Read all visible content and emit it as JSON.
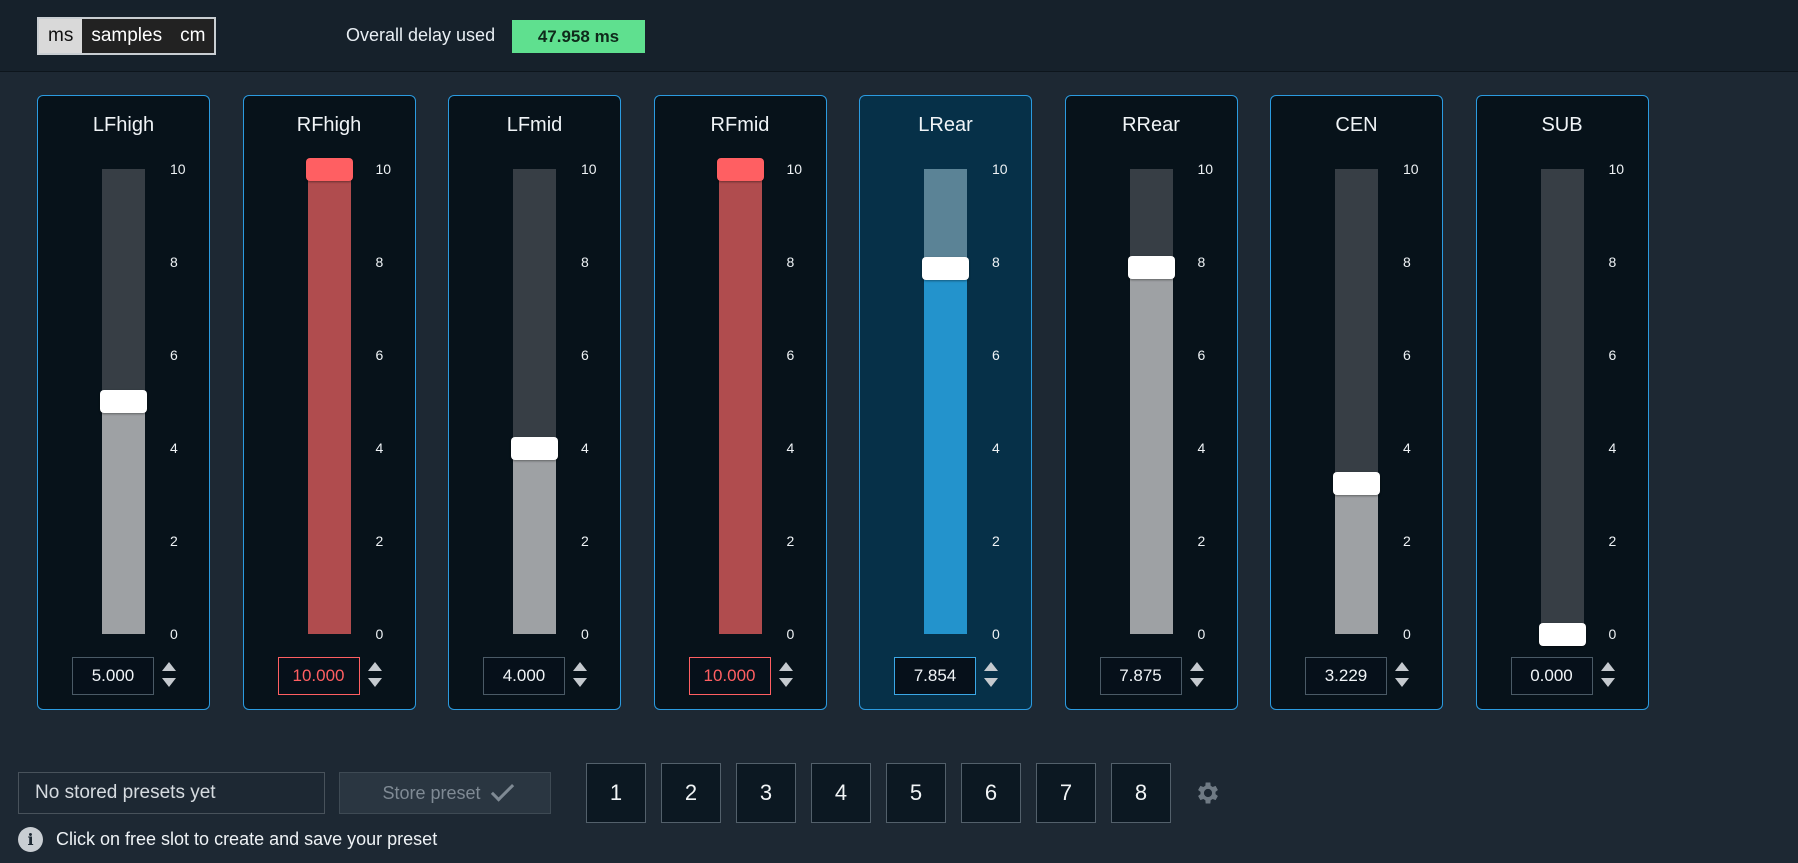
{
  "units": {
    "options": [
      "ms",
      "samples",
      "cm"
    ],
    "active": "ms"
  },
  "delay": {
    "label": "Overall delay used",
    "value": "47.958 ms"
  },
  "scale": {
    "ticks": [
      "10",
      "8",
      "6",
      "4",
      "2",
      "0"
    ],
    "max": 10
  },
  "channels": [
    {
      "name": "LFhigh",
      "value": 5.0,
      "display": "5.000",
      "state": "normal"
    },
    {
      "name": "RFhigh",
      "value": 10.0,
      "display": "10.000",
      "state": "error"
    },
    {
      "name": "LFmid",
      "value": 4.0,
      "display": "4.000",
      "state": "normal"
    },
    {
      "name": "RFmid",
      "value": 10.0,
      "display": "10.000",
      "state": "error"
    },
    {
      "name": "LRear",
      "value": 7.854,
      "display": "7.854",
      "state": "selected"
    },
    {
      "name": "RRear",
      "value": 7.875,
      "display": "7.875",
      "state": "normal"
    },
    {
      "name": "CEN",
      "value": 3.229,
      "display": "3.229",
      "state": "normal"
    },
    {
      "name": "SUB",
      "value": 0.0,
      "display": "0.000",
      "state": "normal"
    }
  ],
  "presets": {
    "field_text": "No stored presets yet",
    "store_label": "Store preset",
    "slots": [
      "1",
      "2",
      "3",
      "4",
      "5",
      "6",
      "7",
      "8"
    ]
  },
  "info": {
    "icon": "info-icon",
    "text": "Click on free slot to create and save your preset"
  },
  "colors": {
    "accent": "#2b9be0",
    "error": "#ff5f62",
    "delay_bg": "#5fe08f",
    "selected_fill": "#2393cc"
  }
}
